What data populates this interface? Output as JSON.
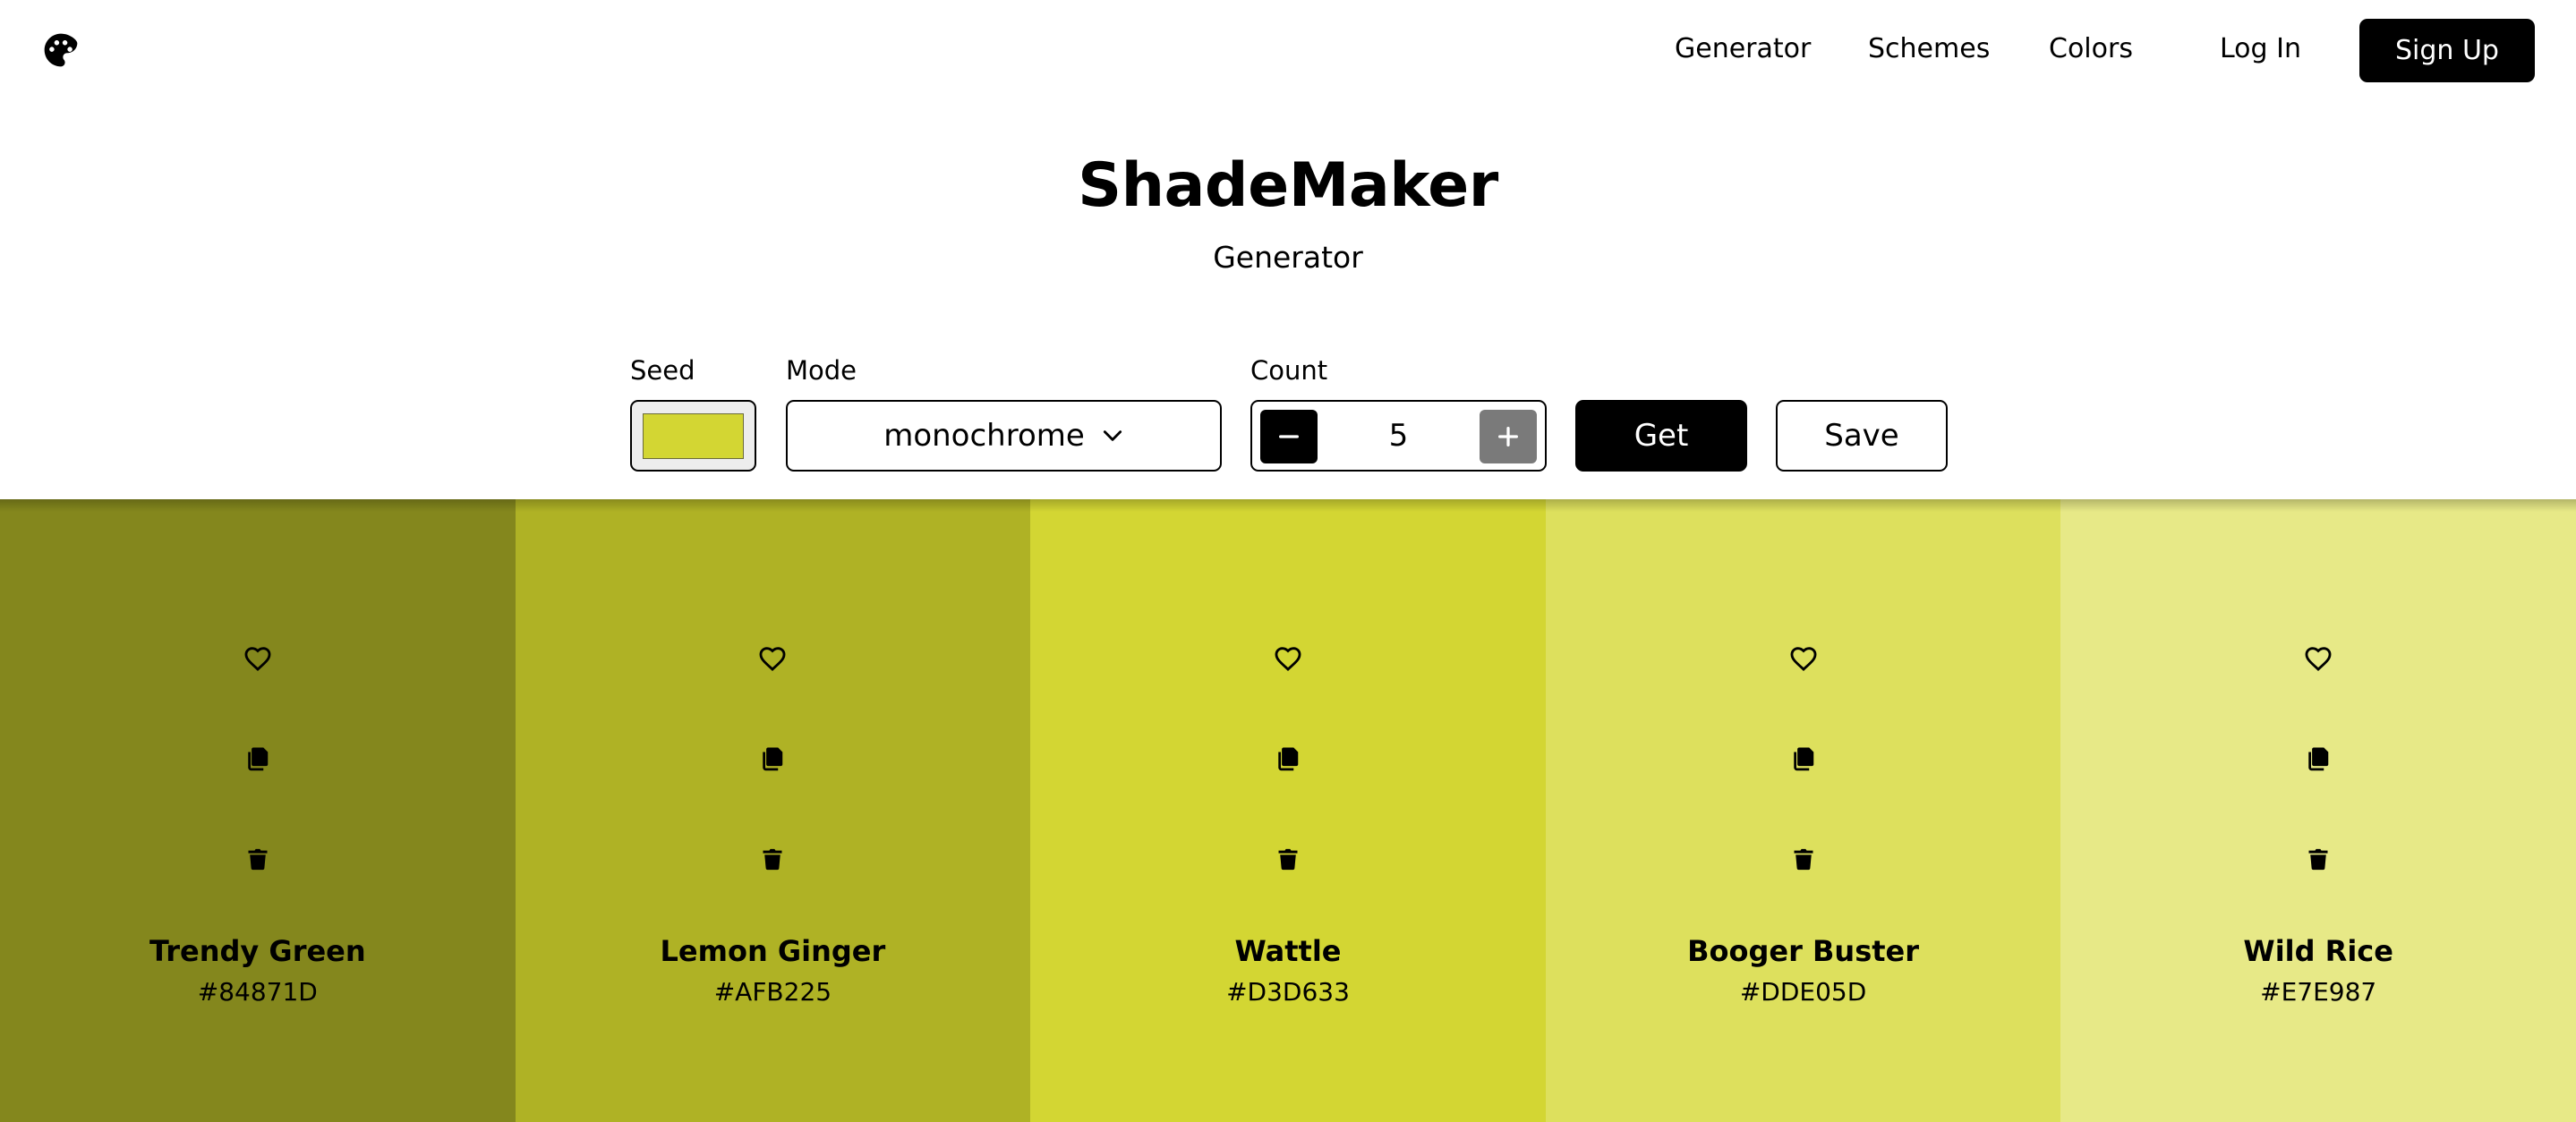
{
  "nav": {
    "logo_icon": "palette-icon",
    "links": [
      "Generator",
      "Schemes",
      "Colors"
    ],
    "login_label": "Log In",
    "signup_label": "Sign Up"
  },
  "hero": {
    "title": "ShadeMaker",
    "subtitle": "Generator"
  },
  "controls": {
    "seed_label": "Seed",
    "seed_color": "#D3D633",
    "mode_label": "Mode",
    "mode_value": "monochrome",
    "count_label": "Count",
    "count_value": "5",
    "get_label": "Get",
    "save_label": "Save"
  },
  "palette": [
    {
      "name": "Trendy Green",
      "hex": "#84871D"
    },
    {
      "name": "Lemon Ginger",
      "hex": "#AFB225"
    },
    {
      "name": "Wattle",
      "hex": "#D3D633"
    },
    {
      "name": "Booger Buster",
      "hex": "#DDE05D"
    },
    {
      "name": "Wild Rice",
      "hex": "#E7E987"
    }
  ]
}
